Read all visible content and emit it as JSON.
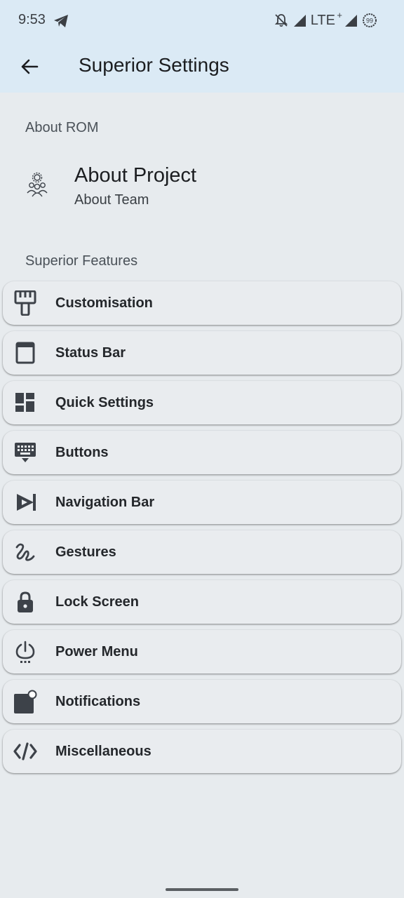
{
  "status": {
    "time": "9:53",
    "network": "LTE",
    "network_plus": "+",
    "battery": "99"
  },
  "appbar": {
    "title": "Superior Settings"
  },
  "about_section": {
    "header": "About ROM",
    "item": {
      "title": "About Project",
      "subtitle": "About Team"
    }
  },
  "features_section": {
    "header": "Superior Features",
    "items": [
      {
        "label": "Customisation",
        "icon": "paint-brush-icon"
      },
      {
        "label": "Status Bar",
        "icon": "window-icon"
      },
      {
        "label": "Quick Settings",
        "icon": "dashboard-icon"
      },
      {
        "label": "Buttons",
        "icon": "keyboard-icon"
      },
      {
        "label": "Navigation Bar",
        "icon": "navigation-icon"
      },
      {
        "label": "Gestures",
        "icon": "gesture-icon"
      },
      {
        "label": "Lock Screen",
        "icon": "lock-icon"
      },
      {
        "label": "Power Menu",
        "icon": "power-icon"
      },
      {
        "label": "Notifications",
        "icon": "notification-icon"
      },
      {
        "label": "Miscellaneous",
        "icon": "code-icon"
      }
    ]
  },
  "colors": {
    "appbar_bg": "#dbeaf5",
    "page_bg": "#e7ebee",
    "card_bg": "#e9ecef",
    "icon": "#3d4249"
  }
}
